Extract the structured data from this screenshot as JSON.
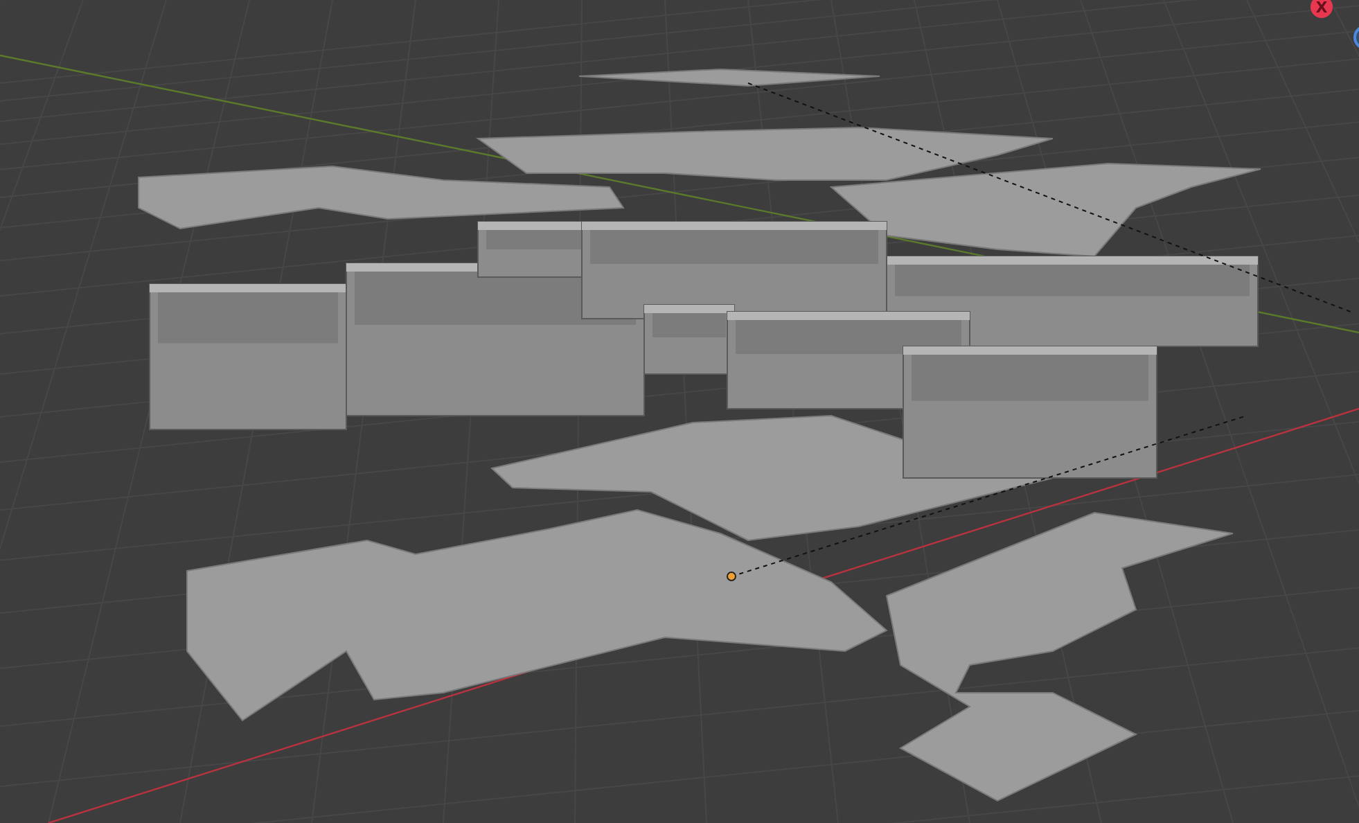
{
  "viewport": {
    "gizmo": {
      "x_label": "X"
    }
  }
}
